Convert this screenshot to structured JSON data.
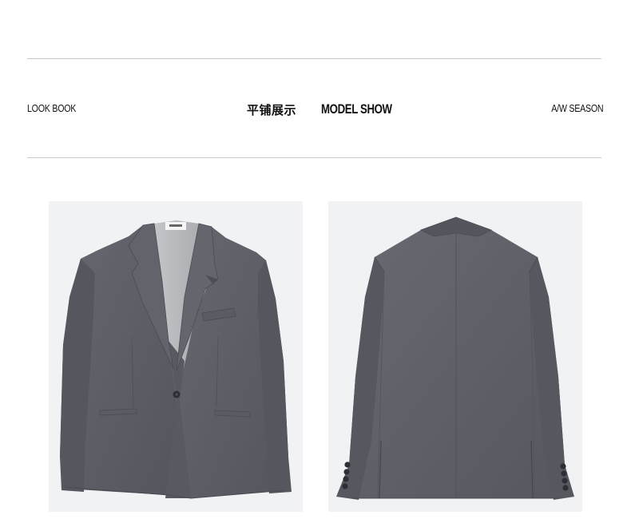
{
  "header": {
    "left_label": "LOOK BOOK",
    "title_cn": "平铺展示",
    "title_en": "MODEL SHOW",
    "right_label": "A/W SEASON"
  },
  "gallery": {
    "items": [
      {
        "name": "front-view",
        "icon": "suit-jacket-front-image"
      },
      {
        "name": "back-view",
        "icon": "suit-jacket-back-image"
      }
    ]
  },
  "colors": {
    "fabric": "#5e6068",
    "fabric_dark": "#4c4e56",
    "lining": "#b8b9bc",
    "photo_bg": "#f1f2f4",
    "rule": "#c9c9c9"
  }
}
